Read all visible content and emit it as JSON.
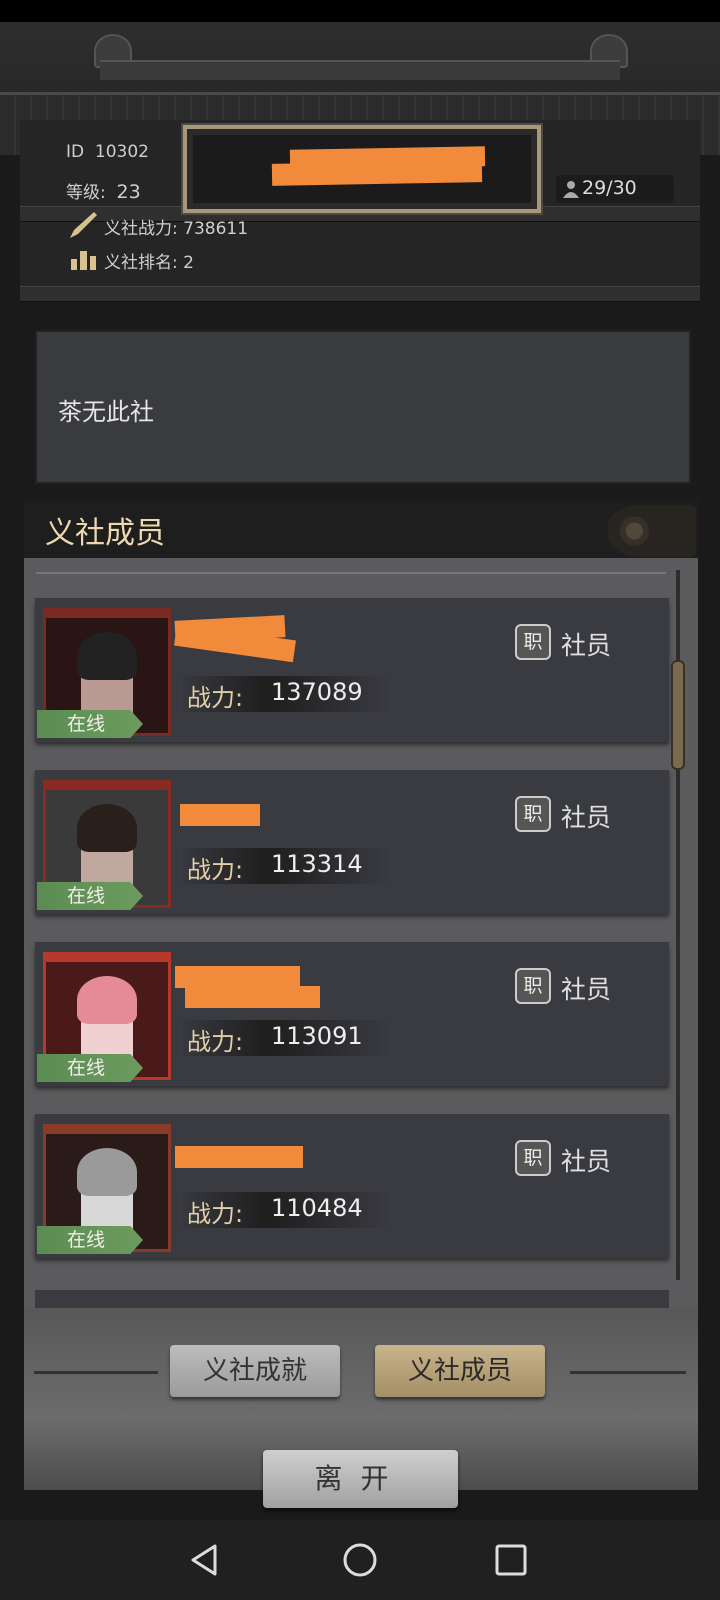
{
  "header": {
    "id_label": "ID",
    "id_value": "10302",
    "level_label": "等级:",
    "level_value": "23",
    "member_count": "29/30",
    "power_label": "义社战力:",
    "power_value": "738611",
    "rank_label": "义社排名:",
    "rank_value": "2"
  },
  "notice": {
    "text": "茶无此社"
  },
  "members_section": {
    "title": "义社成员"
  },
  "members": [
    {
      "status": "在线",
      "power_label": "战力:",
      "power": "137089",
      "role_icon": "职",
      "role": "社员"
    },
    {
      "status": "在线",
      "power_label": "战力:",
      "power": "113314",
      "role_icon": "职",
      "role": "社员"
    },
    {
      "status": "在线",
      "power_label": "战力:",
      "power": "113091",
      "role_icon": "职",
      "role": "社员"
    },
    {
      "status": "在线",
      "power_label": "战力:",
      "power": "110484",
      "role_icon": "职",
      "role": "社员"
    }
  ],
  "tabs": {
    "achievement": "义社成就",
    "members": "义社成员"
  },
  "leave_label": "离开",
  "icons": {
    "person": "person-icon",
    "sword": "brush-sword-icon",
    "rank": "bar-chart-icon",
    "back": "back-triangle-icon",
    "home": "home-circle-icon",
    "recents": "recents-square-icon"
  },
  "colors": {
    "accent_gold": "#ecd9ae",
    "online_green": "#6d9b5f",
    "redaction": "#f28a3c"
  }
}
